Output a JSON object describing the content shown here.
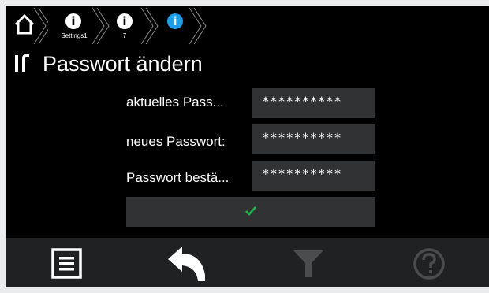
{
  "breadcrumbs": [
    {
      "icon": "info-icon",
      "sublabel": "Settings1",
      "active": false
    },
    {
      "icon": "info-icon",
      "sublabel": "7",
      "active": false
    },
    {
      "icon": "info-icon",
      "sublabel": "",
      "active": true
    }
  ],
  "page": {
    "title": "Passwort ändern",
    "title_icon": "wrench-screwdriver-icon"
  },
  "form": {
    "current": {
      "label": "aktuelles Pass...",
      "value": "**********"
    },
    "new": {
      "label": "neues Passwort:",
      "value": "**********"
    },
    "confirm": {
      "label": "Passwort bestä...",
      "value": "**********"
    },
    "submit_icon": "checkmark-icon"
  },
  "colors": {
    "active_crumb": "#1a9ee8",
    "check": "#1fb84a",
    "field_bg": "#303234",
    "bottom_bar": "#1f2123",
    "disabled_icon": "#4a4c4e"
  },
  "bottombar": {
    "items": [
      "menu-list-icon",
      "back-arrow-icon",
      "filter-icon",
      "help-icon"
    ]
  }
}
